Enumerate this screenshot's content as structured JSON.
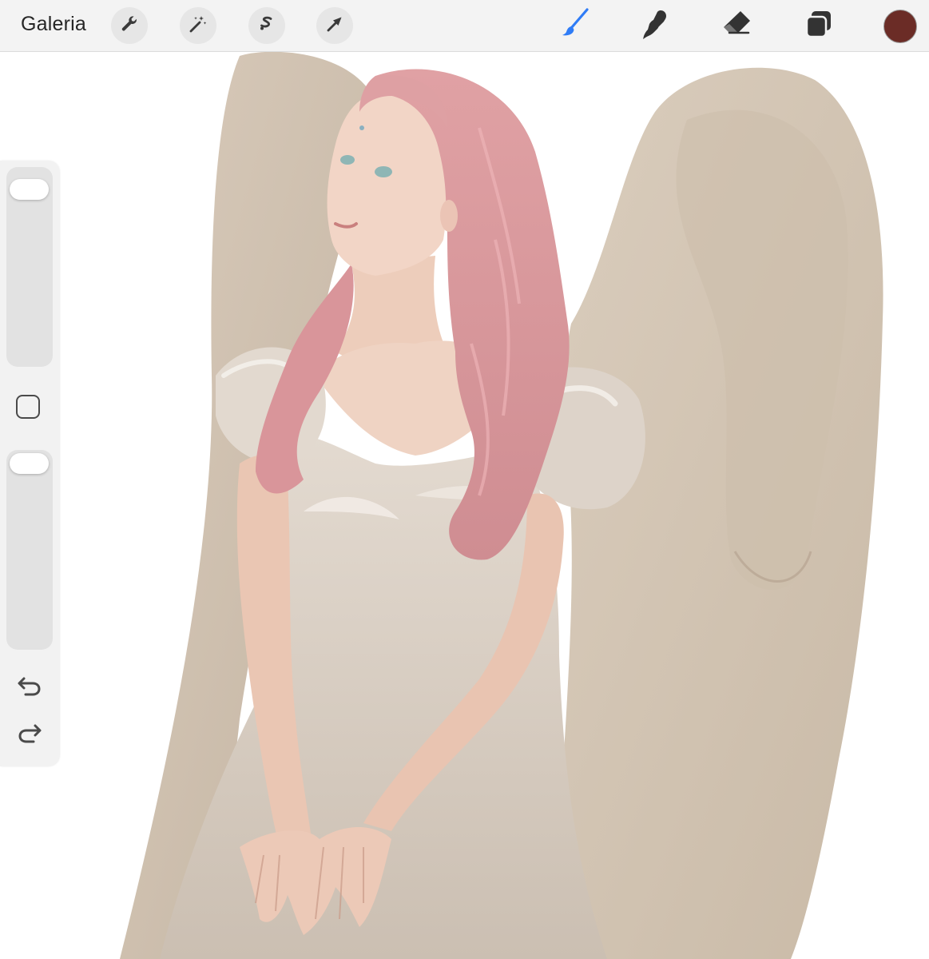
{
  "toolbar": {
    "gallery_label": "Galeria",
    "left_tools": [
      {
        "name": "actions",
        "icon": "wrench-icon"
      },
      {
        "name": "adjustments",
        "icon": "magic-wand-icon"
      },
      {
        "name": "selection",
        "icon": "selection-s-icon"
      },
      {
        "name": "transform",
        "icon": "arrow-icon"
      }
    ],
    "right_tools": [
      {
        "name": "brush",
        "icon": "brush-icon",
        "active": true
      },
      {
        "name": "smudge",
        "icon": "smudge-finger-icon"
      },
      {
        "name": "eraser",
        "icon": "eraser-icon"
      },
      {
        "name": "layers",
        "icon": "layers-icon"
      }
    ],
    "active_color": "#6b2c26",
    "accent_color": "#2f7cf6"
  },
  "sidebar": {
    "brush_size_level": 0.95,
    "opacity_level": 1.0,
    "modify_icon": "square-icon",
    "undo_icon": "undo-arrow-icon",
    "redo_icon": "redo-arrow-icon"
  },
  "canvas": {
    "artwork": "painting-of-angel-with-pink-hair",
    "colors": {
      "wing": "#d6c8b7",
      "wing_shadow": "#bcae9c",
      "hair": "#d9979b",
      "skin": "#efd2c2",
      "dress": "#d8cdc2"
    }
  }
}
